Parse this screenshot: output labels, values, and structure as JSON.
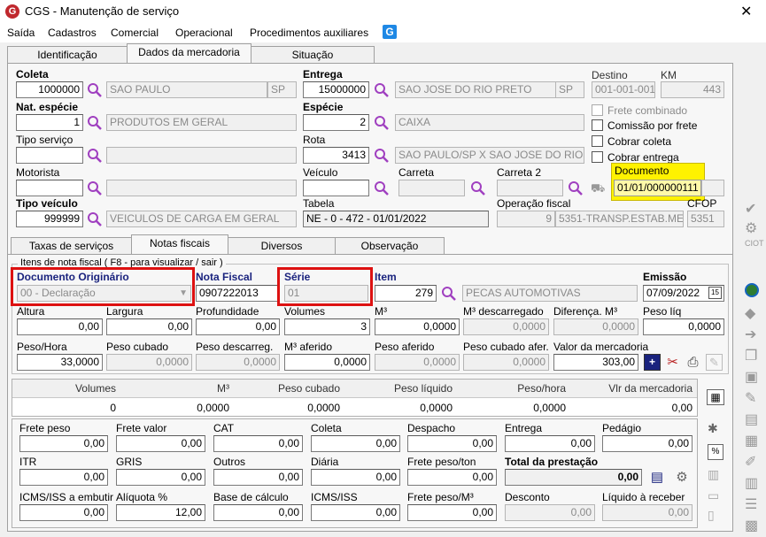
{
  "window": {
    "title": "CGS - Manutenção de serviço",
    "close": "✕"
  },
  "menu": [
    "Saída",
    "Cadastros",
    "Comercial",
    "Operacional",
    "Procedimentos auxiliares"
  ],
  "top_tabs": [
    "Identificação",
    "Dados da mercadoria",
    "Situação"
  ],
  "coleta": {
    "label": "Coleta",
    "value": "1000000",
    "city": "SAO PAULO",
    "uf": "SP"
  },
  "entrega": {
    "label": "Entrega",
    "value": "15000000",
    "city": "SAO JOSE DO RIO PRETO",
    "uf": "SP"
  },
  "destino": {
    "label": "Destino",
    "value": "001-001-001"
  },
  "km": {
    "label": "KM",
    "value": "443"
  },
  "nat_especie": {
    "label": "Nat. espécie",
    "value": "1",
    "desc": "PRODUTOS EM GERAL"
  },
  "especie": {
    "label": "Espécie",
    "value": "2",
    "desc": "CAIXA"
  },
  "checkboxes": {
    "frete_combinado": "Frete combinado",
    "comissao": "Comissão por frete",
    "cobrar_coleta": "Cobrar coleta",
    "cobrar_entrega": "Cobrar entrega"
  },
  "tipo_servico": {
    "label": "Tipo serviço",
    "value": "",
    "desc": ""
  },
  "rota": {
    "label": "Rota",
    "value": "3413",
    "desc": "SAO PAULO/SP X SAO JOSE DO RIO P"
  },
  "motorista": {
    "label": "Motorista"
  },
  "veiculo": {
    "label": "Veículo"
  },
  "carreta": {
    "label": "Carreta"
  },
  "carreta2": {
    "label": "Carreta 2"
  },
  "documento": {
    "label": "Documento",
    "value": "01/01/000000111"
  },
  "tipo_veiculo": {
    "label": "Tipo veículo",
    "value": "999999",
    "desc": "VEICULOS DE CARGA EM GERAL"
  },
  "tabela": {
    "label": "Tabela",
    "value": "NE - 0 - 472 - 01/01/2022"
  },
  "operacao_fiscal": {
    "label": "Operação fiscal",
    "value": "9",
    "desc": "5351-TRANSP.ESTAB.ME"
  },
  "cfop": {
    "label": "CFOP",
    "value": "5351"
  },
  "sub_tabs": [
    "Taxas de serviços",
    "Notas fiscais",
    "Diversos",
    "Observação"
  ],
  "itens_group": "Itens de nota fiscal ( F8 - para visualizar / sair )",
  "doc_originario": {
    "label": "Documento Originário",
    "value": "00 - Declaração"
  },
  "nota_fiscal": {
    "label": "Nota Fiscal",
    "value": "0907222013"
  },
  "serie": {
    "label": "Série",
    "value": "01"
  },
  "item": {
    "label": "Item",
    "value": "279",
    "desc": "PECAS AUTOMOTIVAS"
  },
  "emissao": {
    "label": "Emissão",
    "value": "07/09/2022"
  },
  "row_a": [
    {
      "label": "Altura",
      "value": "0,00"
    },
    {
      "label": "Largura",
      "value": "0,00"
    },
    {
      "label": "Profundidade",
      "value": "0,00"
    },
    {
      "label": "Volumes",
      "value": "3"
    },
    {
      "label": "M³",
      "value": "0,0000"
    },
    {
      "label": "M³ descarregado",
      "value": "0,0000"
    },
    {
      "label": "Diferença. M³",
      "value": "0,0000"
    },
    {
      "label": "Peso líq",
      "value": "0,0000"
    }
  ],
  "row_b": [
    {
      "label": "Peso/Hora",
      "value": "33,0000"
    },
    {
      "label": "Peso cubado",
      "value": "0,0000"
    },
    {
      "label": "Peso descarreg.",
      "value": "0,0000"
    },
    {
      "label": "M³ aferido",
      "value": "0,0000"
    },
    {
      "label": "Peso aferido",
      "value": "0,0000"
    },
    {
      "label": "Peso cubado afer.",
      "value": "0,0000"
    },
    {
      "label": "Valor da mercadoria",
      "value": "303,00"
    }
  ],
  "summary": [
    {
      "label": "Volumes",
      "value": "0"
    },
    {
      "label": "M³",
      "value": "0,0000"
    },
    {
      "label": "Peso cubado",
      "value": "0,0000"
    },
    {
      "label": "Peso líquido",
      "value": "0,0000"
    },
    {
      "label": "Peso/hora",
      "value": "0,0000"
    },
    {
      "label": "Vlr da mercadoria",
      "value": "0,00"
    }
  ],
  "fee_row1": [
    {
      "label": "Frete peso",
      "value": "0,00"
    },
    {
      "label": "Frete valor",
      "value": "0,00"
    },
    {
      "label": "CAT",
      "value": "0,00"
    },
    {
      "label": "Coleta",
      "value": "0,00"
    },
    {
      "label": "Despacho",
      "value": "0,00"
    },
    {
      "label": "Entrega",
      "value": "0,00"
    },
    {
      "label": "Pedágio",
      "value": "0,00"
    }
  ],
  "fee_row2": [
    {
      "label": "ITR",
      "value": "0,00"
    },
    {
      "label": "GRIS",
      "value": "0,00"
    },
    {
      "label": "Outros",
      "value": "0,00"
    },
    {
      "label": "Diária",
      "value": "0,00"
    },
    {
      "label": "Frete peso/ton",
      "value": "0,00"
    },
    {
      "label": "Total da prestação",
      "value": "0,00"
    }
  ],
  "fee_row3": [
    {
      "label": "ICMS/ISS a embutir",
      "value": "0,00"
    },
    {
      "label": "Alíquota %",
      "value": "12,00"
    },
    {
      "label": "Base de cálculo",
      "value": "0,00"
    },
    {
      "label": "ICMS/ISS",
      "value": "0,00"
    },
    {
      "label": "Frete peso/M³",
      "value": "0,00"
    },
    {
      "label": "Desconto",
      "value": "0,00"
    },
    {
      "label": "Líquido à receber",
      "value": "0,00"
    }
  ],
  "colors": {
    "highlight_red": "#dd1111",
    "highlight_yellow": "#fff200",
    "lupa": "#a040c0"
  }
}
